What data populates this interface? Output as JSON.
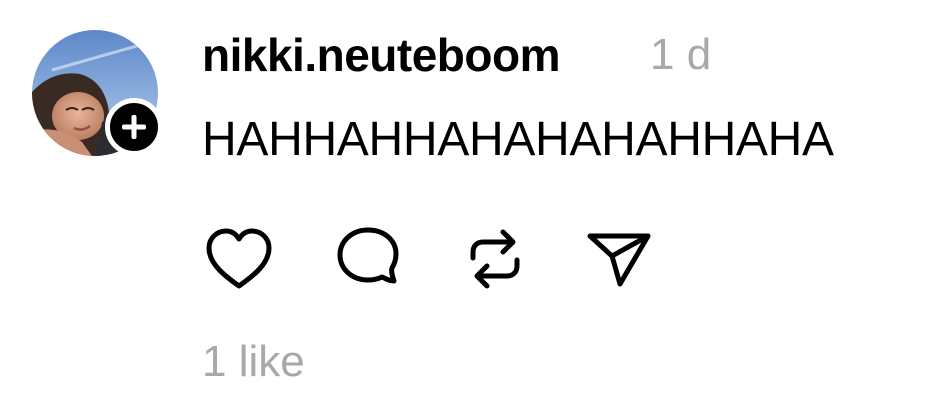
{
  "post": {
    "username": "nikki.neuteboom",
    "timestamp": "1 d",
    "text": "HAHHAHHAHAHAHAHHAHA",
    "likes_label": "1 like"
  },
  "actions": [
    {
      "name": "like",
      "icon": "heart-icon"
    },
    {
      "name": "comment",
      "icon": "comment-bubble-icon"
    },
    {
      "name": "repost",
      "icon": "repost-icon"
    },
    {
      "name": "share",
      "icon": "send-icon"
    }
  ],
  "avatar": {
    "badge_icon": "plus-icon"
  },
  "colors": {
    "text": "#000000",
    "muted": "#a8a8a8",
    "background": "#ffffff",
    "badge": "#000000"
  }
}
